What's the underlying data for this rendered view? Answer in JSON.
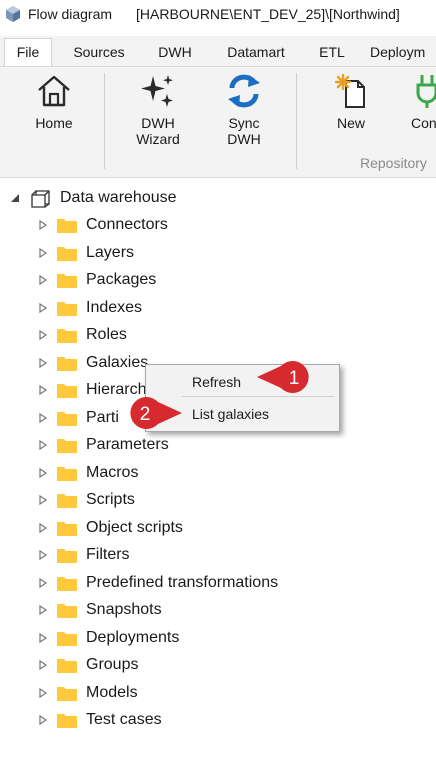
{
  "window": {
    "title": "Flow diagram",
    "connection": "[HARBOURNE\\ENT_DEV_25]\\[Northwind]"
  },
  "tabs": [
    "File",
    "Sources",
    "DWH",
    "Datamart",
    "ETL",
    "Deploym"
  ],
  "ribbon": {
    "home": "Home",
    "dwh_wizard": [
      "DWH",
      "Wizard"
    ],
    "sync_dwh": [
      "Sync",
      "DWH"
    ],
    "new": "New",
    "con": "Con",
    "group": "Repository"
  },
  "tree": {
    "root": "Data warehouse",
    "items": [
      "Connectors",
      "Layers",
      "Packages",
      "Indexes",
      "Roles",
      "Galaxies",
      "Hierarch",
      "Parti",
      "Parameters",
      "Macros",
      "Scripts",
      "Object scripts",
      "Filters",
      "Predefined transformations",
      "Snapshots",
      "Deployments",
      "Groups",
      "Models",
      "Test cases"
    ]
  },
  "context_menu": {
    "items": [
      "Refresh",
      "List galaxies"
    ]
  },
  "callouts": [
    "1",
    "2"
  ],
  "colors": {
    "folder": "#FFC83D",
    "callout": "#D62A2E",
    "sync": "#1A6FC4",
    "plug": "#3BA84A"
  }
}
